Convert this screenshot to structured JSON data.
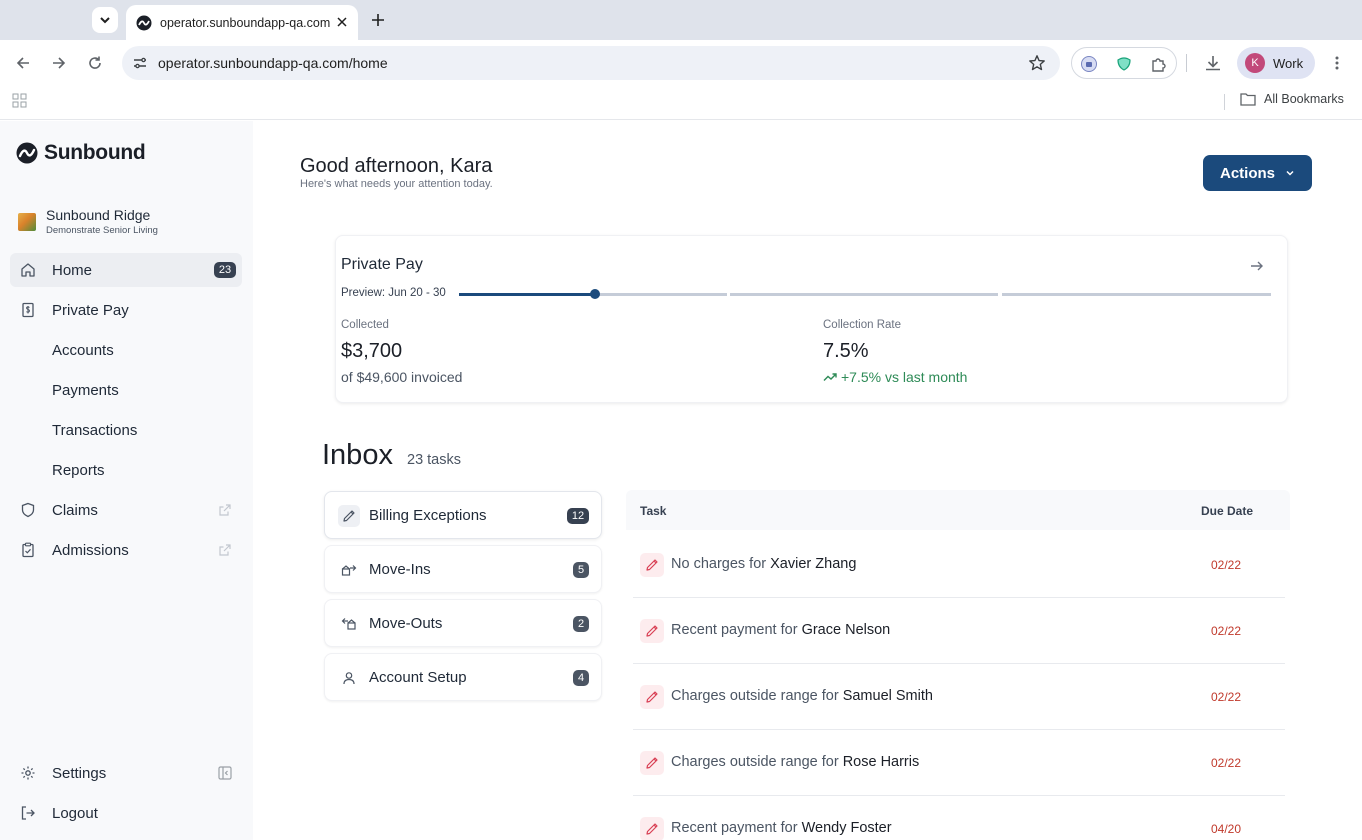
{
  "browser": {
    "tab_title": "operator.sunboundapp-qa.com/home",
    "url": "operator.sunboundapp-qa.com/home",
    "profile_initial": "K",
    "profile_name": "Work",
    "all_bookmarks": "All Bookmarks"
  },
  "sidebar": {
    "brand": "Sunbound",
    "facility_name": "Sunbound Ridge",
    "facility_sub": "Demonstrate Senior Living",
    "items": [
      {
        "label": "Home",
        "badge": "23"
      },
      {
        "label": "Private Pay"
      },
      {
        "label": "Accounts"
      },
      {
        "label": "Payments"
      },
      {
        "label": "Transactions"
      },
      {
        "label": "Reports"
      },
      {
        "label": "Claims"
      },
      {
        "label": "Admissions"
      }
    ],
    "settings": "Settings",
    "logout": "Logout"
  },
  "main": {
    "greeting": "Good afternoon, Kara",
    "greeting_sub": "Here's what needs your attention today.",
    "actions_label": "Actions",
    "private_pay": {
      "title": "Private Pay",
      "preview": "Preview: Jun 20 - 30",
      "progress_fraction": 0.167,
      "collected_label": "Collected",
      "collected_value": "$3,700",
      "collected_sub": "of $49,600 invoiced",
      "rate_label": "Collection Rate",
      "rate_value": "7.5%",
      "rate_trend": "+7.5% vs last month"
    },
    "inbox": {
      "title": "Inbox",
      "count": "23 tasks",
      "categories": [
        {
          "label": "Billing Exceptions",
          "count": "12"
        },
        {
          "label": "Move-Ins",
          "count": "5"
        },
        {
          "label": "Move-Outs",
          "count": "2"
        },
        {
          "label": "Account Setup",
          "count": "4"
        }
      ],
      "columns": {
        "task": "Task",
        "due": "Due Date"
      },
      "tasks": [
        {
          "prefix": "No charges for ",
          "name": "Xavier Zhang",
          "due": "02/22"
        },
        {
          "prefix": "Recent payment for ",
          "name": "Grace Nelson",
          "due": "02/22"
        },
        {
          "prefix": "Charges outside range for ",
          "name": "Samuel Smith",
          "due": "02/22"
        },
        {
          "prefix": "Charges outside range for ",
          "name": "Rose Harris",
          "due": "02/22"
        },
        {
          "prefix": "Recent payment for ",
          "name": "Wendy Foster",
          "due": "04/20"
        }
      ]
    }
  },
  "colors": {
    "accent": "#1b4a7c",
    "due_red": "#c0392b",
    "trend_green": "#2e8b57"
  },
  "icons": [
    "chevron-down-icon",
    "sunbound-favicon",
    "close-icon",
    "plus-icon",
    "back-icon",
    "forward-icon",
    "reload-icon",
    "tune-icon",
    "star-icon",
    "extension-icon",
    "download-icon",
    "kebab-icon",
    "apps-icon",
    "folder-icon",
    "home-icon",
    "dollar-doc-icon",
    "shield-icon",
    "clipboard-icon",
    "external-link-icon",
    "gear-icon",
    "sidebar-collapse-icon",
    "logout-icon",
    "arrow-right-icon",
    "trend-up-icon",
    "pencil-icon",
    "move-in-icon",
    "move-out-icon",
    "user-icon"
  ]
}
